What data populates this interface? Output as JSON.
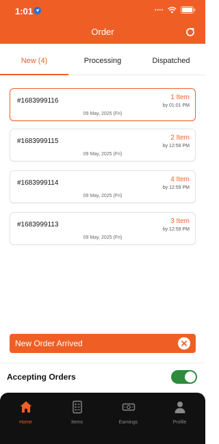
{
  "status_bar": {
    "time": "1:01"
  },
  "header": {
    "title": "Order"
  },
  "tabs": [
    {
      "label": "New (4)",
      "active": true
    },
    {
      "label": "Processing",
      "active": false
    },
    {
      "label": "Dispatched",
      "active": false
    }
  ],
  "orders": [
    {
      "id": "#1683999116",
      "items": "1 Item",
      "time": "by 01:01 PM",
      "date": "09 May, 2025 (Fri)",
      "selected": true
    },
    {
      "id": "#1683999115",
      "items": "2 Item",
      "time": "by 12:59 PM",
      "date": "09 May, 2025 (Fri)",
      "selected": false
    },
    {
      "id": "#1683999114",
      "items": "4 Item",
      "time": "by 12:59 PM",
      "date": "09 May, 2025 (Fri)",
      "selected": false
    },
    {
      "id": "#1683999113",
      "items": "3 Item",
      "time": "by 12:59 PM",
      "date": "09 May, 2025 (Fri)",
      "selected": false
    }
  ],
  "toast": {
    "text": "New Order Arrived"
  },
  "accepting": {
    "label": "Accepting Orders",
    "enabled": true
  },
  "bottom_nav": [
    {
      "label": "Home",
      "icon": "home-icon",
      "active": true
    },
    {
      "label": "Items",
      "icon": "items-icon",
      "active": false
    },
    {
      "label": "Earnings",
      "icon": "earnings-icon",
      "active": false
    },
    {
      "label": "Profile",
      "icon": "profile-icon",
      "active": false
    }
  ],
  "colors": {
    "accent": "#ef5f25",
    "toggle_on": "#2e8b3b",
    "nav_bg": "#111111"
  }
}
